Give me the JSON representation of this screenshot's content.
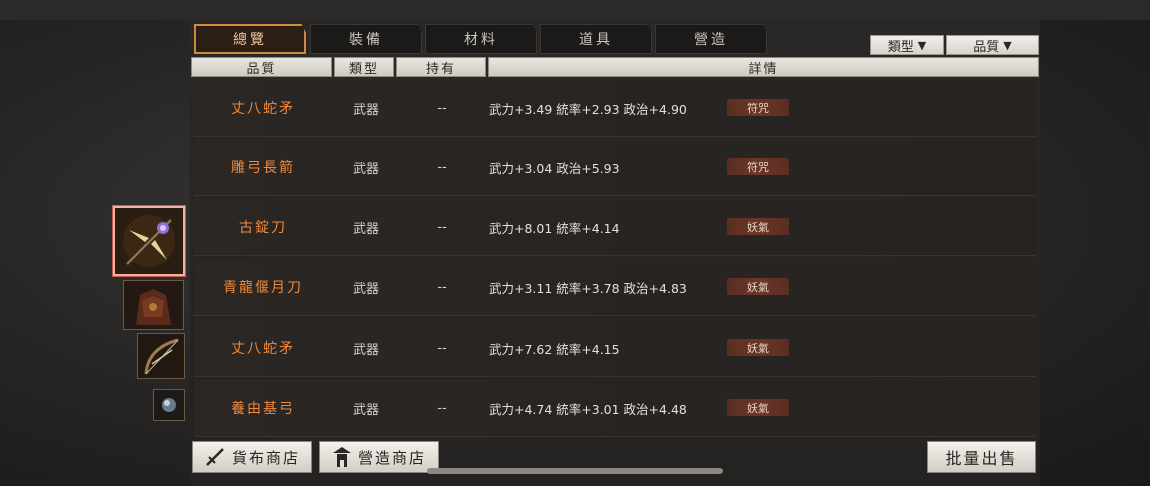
{
  "tabs": [
    {
      "label": "總覽",
      "active": true
    },
    {
      "label": "裝備",
      "active": false
    },
    {
      "label": "材料",
      "active": false
    },
    {
      "label": "道具",
      "active": false
    },
    {
      "label": "營造",
      "active": false
    }
  ],
  "filters": {
    "type_label": "類型",
    "quality_label": "品質"
  },
  "columns": {
    "quality": "品質",
    "type": "類型",
    "owned": "持有",
    "details": "詳情"
  },
  "rows": [
    {
      "name": "丈八蛇矛",
      "type": "武器",
      "owned": "--",
      "details": "武力+3.49  統率+2.93  政治+4.90",
      "badge": "符咒"
    },
    {
      "name": "雕弓長箭",
      "type": "武器",
      "owned": "--",
      "details": "武力+3.04  政治+5.93",
      "badge": "符咒"
    },
    {
      "name": "古錠刀",
      "type": "武器",
      "owned": "--",
      "details": "武力+8.01  統率+4.14",
      "badge": "妖氣"
    },
    {
      "name": "青龍偃月刀",
      "type": "武器",
      "owned": "--",
      "details": "武力+3.11  統率+3.78  政治+4.83",
      "badge": "妖氣"
    },
    {
      "name": "丈八蛇矛",
      "type": "武器",
      "owned": "--",
      "details": "武力+7.62  統率+4.15",
      "badge": "妖氣"
    },
    {
      "name": "養由基弓",
      "type": "武器",
      "owned": "--",
      "details": "武力+4.74  統率+3.01  政治+4.48",
      "badge": "妖氣"
    }
  ],
  "buttons": {
    "currency_shop": "貨布商店",
    "build_shop": "營造商店",
    "bulk_sell": "批量出售"
  },
  "colors": {
    "accent": "#d18a3c",
    "item_name": "#f08a3a",
    "badge_bg": "#6b3627"
  }
}
